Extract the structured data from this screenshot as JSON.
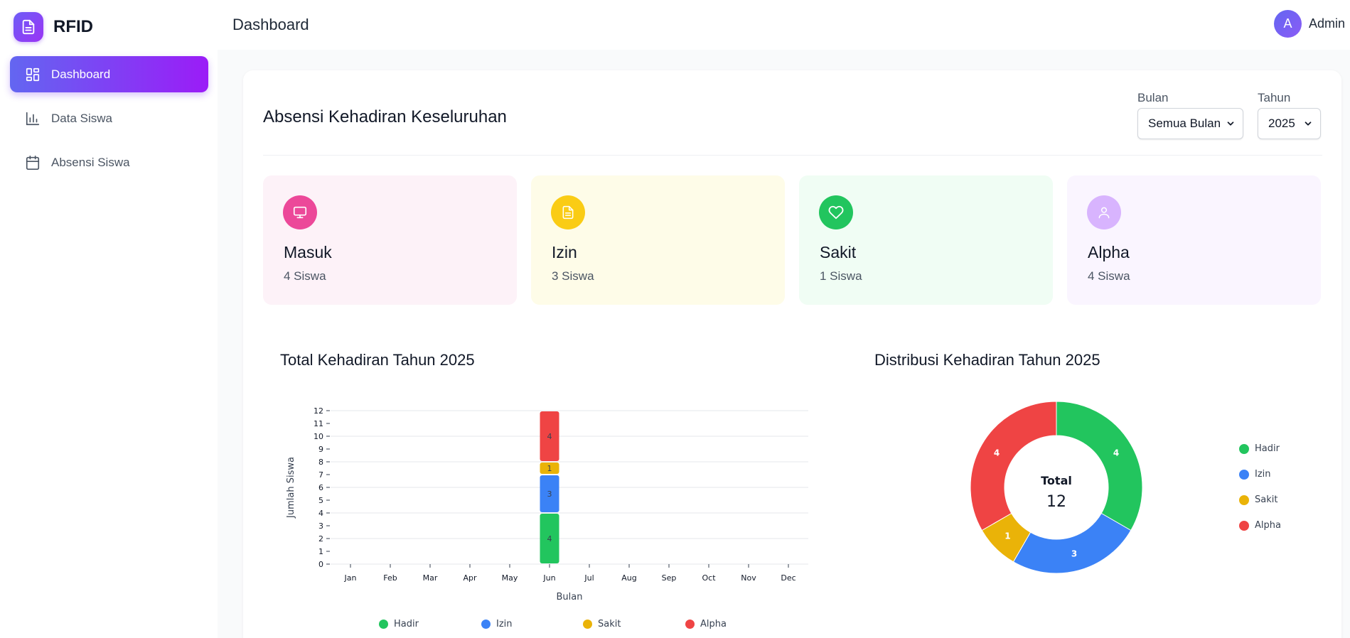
{
  "brand": {
    "name": "RFID"
  },
  "sidebar": {
    "items": [
      {
        "label": "Dashboard",
        "icon": "dashboard-grid-icon",
        "active": true
      },
      {
        "label": "Data Siswa",
        "icon": "bar-chart-icon",
        "active": false
      },
      {
        "label": "Absensi Siswa",
        "icon": "calendar-icon",
        "active": false
      }
    ]
  },
  "header": {
    "title": "Dashboard",
    "user_initial": "A",
    "user_name": "Admin"
  },
  "main": {
    "title": "Absensi Kehadiran Keseluruhan",
    "filters": {
      "month_label": "Bulan",
      "month_value": "Semua Bulan",
      "year_label": "Tahun",
      "year_value": "2025"
    },
    "stats": [
      {
        "title": "Masuk",
        "value": "4 Siswa",
        "icon": "monitor-icon",
        "bg": "#fdf2f8",
        "icon_bg": "#ec4899"
      },
      {
        "title": "Izin",
        "value": "3 Siswa",
        "icon": "document-icon",
        "bg": "#fefce8",
        "icon_bg": "#facc15"
      },
      {
        "title": "Sakit",
        "value": "1 Siswa",
        "icon": "heart-icon",
        "bg": "#f0fdf4",
        "icon_bg": "#22c55e"
      },
      {
        "title": "Alpha",
        "value": "4 Siswa",
        "icon": "user-icon",
        "bg": "#faf5ff",
        "icon_bg": "#d8b4fe"
      }
    ]
  },
  "chart_data": [
    {
      "type": "bar",
      "stacked": true,
      "title": "Total Kehadiran Tahun 2025",
      "xlabel": "Bulan",
      "ylabel": "Jumlah Siswa",
      "ylim": [
        0,
        12
      ],
      "yticks": [
        0,
        1,
        2,
        3,
        4,
        5,
        6,
        7,
        8,
        9,
        10,
        11,
        12
      ],
      "categories": [
        "Jan",
        "Feb",
        "Mar",
        "Apr",
        "May",
        "Jun",
        "Jul",
        "Aug",
        "Sep",
        "Oct",
        "Nov",
        "Dec"
      ],
      "series": [
        {
          "name": "Hadir",
          "color": "#22c55e",
          "values": [
            0,
            0,
            0,
            0,
            0,
            4,
            0,
            0,
            0,
            0,
            0,
            0
          ]
        },
        {
          "name": "Izin",
          "color": "#3b82f6",
          "values": [
            0,
            0,
            0,
            0,
            0,
            3,
            0,
            0,
            0,
            0,
            0,
            0
          ]
        },
        {
          "name": "Sakit",
          "color": "#eab308",
          "values": [
            0,
            0,
            0,
            0,
            0,
            1,
            0,
            0,
            0,
            0,
            0,
            0
          ]
        },
        {
          "name": "Alpha",
          "color": "#ef4444",
          "values": [
            0,
            0,
            0,
            0,
            0,
            4,
            0,
            0,
            0,
            0,
            0,
            0
          ]
        }
      ],
      "legend_position": "bottom",
      "grid": true
    },
    {
      "type": "pie",
      "donut": true,
      "title": "Distribusi Kehadiran Tahun 2025",
      "center_label": "Total",
      "center_value": "12",
      "slices": [
        {
          "name": "Hadir",
          "value": 4,
          "color": "#22c55e"
        },
        {
          "name": "Izin",
          "value": 3,
          "color": "#3b82f6"
        },
        {
          "name": "Sakit",
          "value": 1,
          "color": "#eab308"
        },
        {
          "name": "Alpha",
          "value": 4,
          "color": "#ef4444"
        }
      ],
      "legend_position": "right"
    }
  ]
}
